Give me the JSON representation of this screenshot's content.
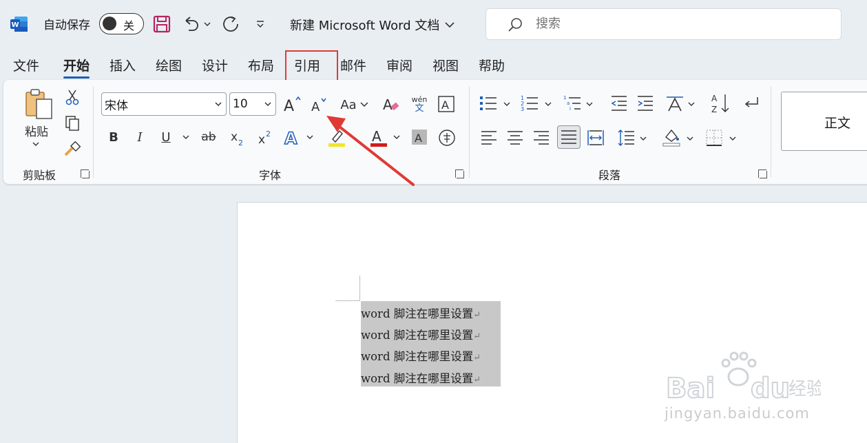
{
  "titlebar": {
    "autosave_label": "自动保存",
    "autosave_state": "关",
    "doc_title": "新建 Microsoft Word 文档",
    "search_placeholder": "搜索"
  },
  "tabs": [
    {
      "label": "文件"
    },
    {
      "label": "开始"
    },
    {
      "label": "插入"
    },
    {
      "label": "绘图"
    },
    {
      "label": "设计"
    },
    {
      "label": "布局"
    },
    {
      "label": "引用"
    },
    {
      "label": "邮件"
    },
    {
      "label": "审阅"
    },
    {
      "label": "视图"
    },
    {
      "label": "帮助"
    }
  ],
  "ribbon": {
    "clipboard": {
      "paste_label": "粘贴",
      "group_label": "剪贴板"
    },
    "font": {
      "font_name": "宋体",
      "font_size": "10",
      "group_label": "字体",
      "case_label": "Aa",
      "phonetic_top": "wén",
      "phonetic_bottom": "文"
    },
    "paragraph": {
      "group_label": "段落"
    },
    "styles": {
      "normal_label": "正文"
    }
  },
  "document": {
    "lines": [
      "word 脚注在哪里设置",
      "word 脚注在哪里设置",
      "word 脚注在哪里设置",
      "word 脚注在哪里设置"
    ]
  },
  "watermark": {
    "text": "jingyan.baidu.com"
  },
  "colors": {
    "accent": "#1d5db8",
    "highlight_box": "#e03a35",
    "arrow": "#e03a35"
  }
}
